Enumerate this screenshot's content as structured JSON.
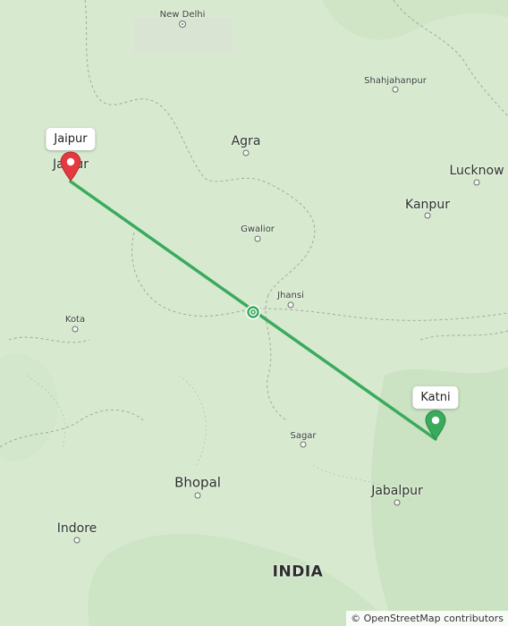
{
  "map": {
    "places": [
      {
        "id": "new-delhi",
        "name": "New Delhi",
        "size": "small",
        "capital": true
      },
      {
        "id": "agra",
        "name": "Agra",
        "size": "medium"
      },
      {
        "id": "shahjahanpur",
        "name": "Shahjahanpur",
        "size": "small"
      },
      {
        "id": "lucknow",
        "name": "Lucknow",
        "size": "medium"
      },
      {
        "id": "kanpur",
        "name": "Kanpur",
        "size": "medium"
      },
      {
        "id": "gwalior",
        "name": "Gwalior",
        "size": "small"
      },
      {
        "id": "jhansi",
        "name": "Jhansi",
        "size": "small"
      },
      {
        "id": "kota",
        "name": "Kota",
        "size": "small"
      },
      {
        "id": "sagar",
        "name": "Sagar",
        "size": "small"
      },
      {
        "id": "bhopal",
        "name": "Bhopal",
        "size": "large"
      },
      {
        "id": "jabalpur",
        "name": "Jabalpur",
        "size": "medium"
      },
      {
        "id": "indore",
        "name": "Indore",
        "size": "medium"
      },
      {
        "id": "jaipur-base",
        "name": "Jaipur",
        "size": "medium"
      }
    ],
    "country_label": "INDIA",
    "route": {
      "origin": {
        "label": "Jaipur",
        "marker_color": "#e53940"
      },
      "destination": {
        "label": "Katni",
        "marker_color": "#3aaa5c"
      },
      "line_color": "#3aaa5c"
    },
    "attribution": "© OpenStreetMap contributors"
  }
}
